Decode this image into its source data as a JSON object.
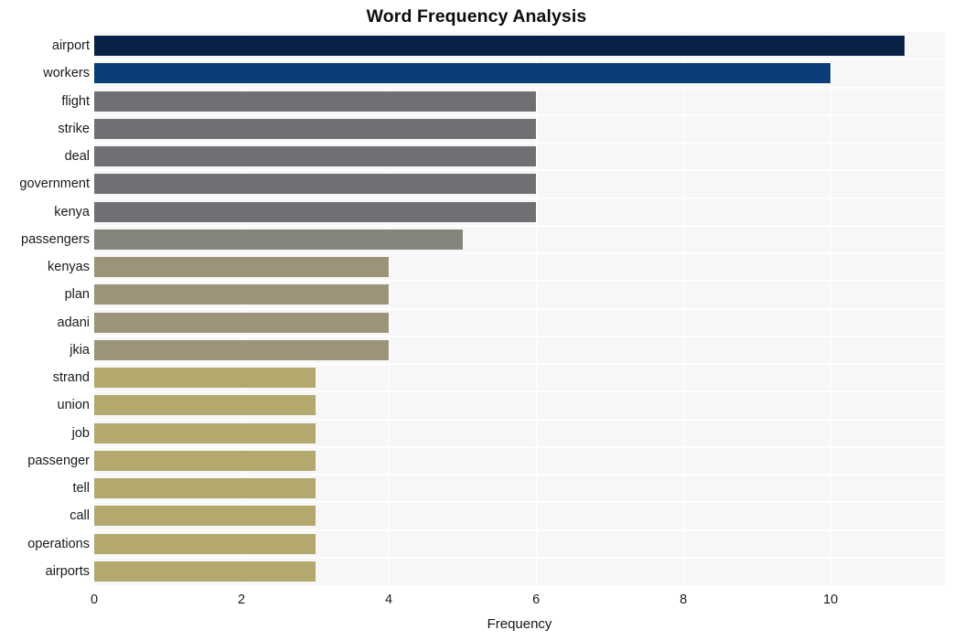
{
  "chart_data": {
    "type": "bar",
    "orientation": "horizontal",
    "title": "Word Frequency Analysis",
    "xlabel": "Frequency",
    "ylabel": "",
    "xlim": [
      0,
      11.55
    ],
    "ylim": [
      0,
      20
    ],
    "grid": true,
    "legend": null,
    "xticks": [
      "0",
      "2",
      "4",
      "6",
      "8",
      "10"
    ],
    "xtick_values": [
      0,
      2,
      4,
      6,
      8,
      10
    ],
    "categories": [
      "airport",
      "workers",
      "flight",
      "strike",
      "deal",
      "government",
      "kenya",
      "passengers",
      "kenyas",
      "plan",
      "adani",
      "jkia",
      "strand",
      "union",
      "job",
      "passenger",
      "tell",
      "call",
      "operations",
      "airports"
    ],
    "values": [
      11,
      10,
      6,
      6,
      6,
      6,
      6,
      5,
      4,
      4,
      4,
      4,
      3,
      3,
      3,
      3,
      3,
      3,
      3,
      3
    ],
    "bar_colors": [
      "#0a2147",
      "#0b3d7b",
      "#6e7073",
      "#6e7073",
      "#6e7073",
      "#6e7073",
      "#6e7073",
      "#85847a",
      "#9c9479",
      "#9c9479",
      "#9c9479",
      "#9c9479",
      "#b3a86e",
      "#b3a86e",
      "#b3a86e",
      "#b3a86e",
      "#b3a86e",
      "#b3a86e",
      "#b3a86e",
      "#b3a86e"
    ],
    "plot_background": "#f7f7f7",
    "figure_background": "#ffffff",
    "gridline_color": "#ffffff"
  }
}
